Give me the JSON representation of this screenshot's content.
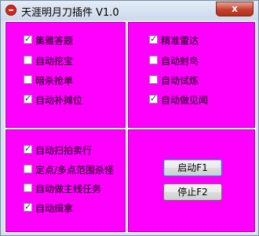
{
  "window": {
    "title": "天涯明月刀插件 V1.0",
    "close": "x"
  },
  "panel_top_left": {
    "items": [
      {
        "label": "集雅答题",
        "checked": true
      },
      {
        "label": "自动挖宝",
        "checked": false
      },
      {
        "label": "暗杀抢单",
        "checked": false
      },
      {
        "label": "自动补摊位",
        "checked": true
      }
    ]
  },
  "panel_top_right": {
    "items": [
      {
        "label": "精准雷达",
        "checked": true
      },
      {
        "label": "自动射鸟",
        "checked": false
      },
      {
        "label": "自动试炼",
        "checked": false
      },
      {
        "label": "自动做见闻",
        "checked": true
      }
    ]
  },
  "panel_bottom_left": {
    "items": [
      {
        "label": "自动扫拍卖行",
        "checked": true
      },
      {
        "label": "定点/多点范围杀怪",
        "checked": false
      },
      {
        "label": "自动做主线任务",
        "checked": false
      },
      {
        "label": "自动缉拿",
        "checked": true
      }
    ]
  },
  "buttons": {
    "start": "启动F1",
    "stop": "停止F2"
  },
  "colors": {
    "panel_bg": "#ff00ff",
    "window_bg": "#d6e2f0",
    "close_red": "#c4412c"
  }
}
